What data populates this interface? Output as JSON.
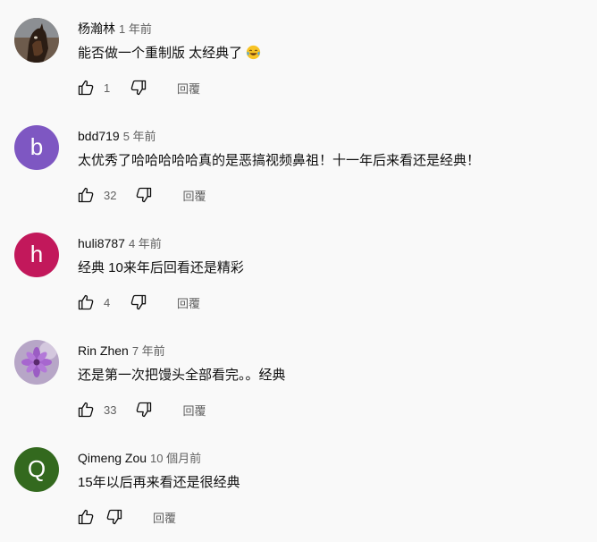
{
  "comments": [
    {
      "author": "杨瀚林",
      "time": "1 年前",
      "text": "能否做一个重制版 太经典了",
      "emoji": "tears-of-joy-emoji",
      "likes": "1",
      "reply_label": "回覆",
      "avatar": {
        "type": "photo-horse"
      }
    },
    {
      "author": "bdd719",
      "time": "5 年前",
      "text": "太优秀了哈哈哈哈哈真的是恶搞视频鼻祖！十一年后来看还是经典！",
      "likes": "32",
      "reply_label": "回覆",
      "avatar": {
        "type": "letter",
        "letter": "b",
        "color": "#7e57c2"
      }
    },
    {
      "author": "huli8787",
      "time": "4 年前",
      "text": "经典 10来年后回看还是精彩",
      "likes": "4",
      "reply_label": "回覆",
      "avatar": {
        "type": "letter",
        "letter": "h",
        "color": "#c2185b"
      }
    },
    {
      "author": "Rin Zhen",
      "time": "7 年前",
      "text": "还是第一次把馒头全部看完。。经典",
      "likes": "33",
      "reply_label": "回覆",
      "avatar": {
        "type": "photo-flower"
      }
    },
    {
      "author": "Qimeng Zou",
      "time": "10 個月前",
      "text": "15年以后再来看还是很经典",
      "likes": "",
      "reply_label": "回覆",
      "avatar": {
        "type": "letter",
        "letter": "Q",
        "color": "#33691e"
      }
    }
  ],
  "icons": {
    "like": "thumb-up-icon",
    "dislike": "thumb-down-icon"
  }
}
